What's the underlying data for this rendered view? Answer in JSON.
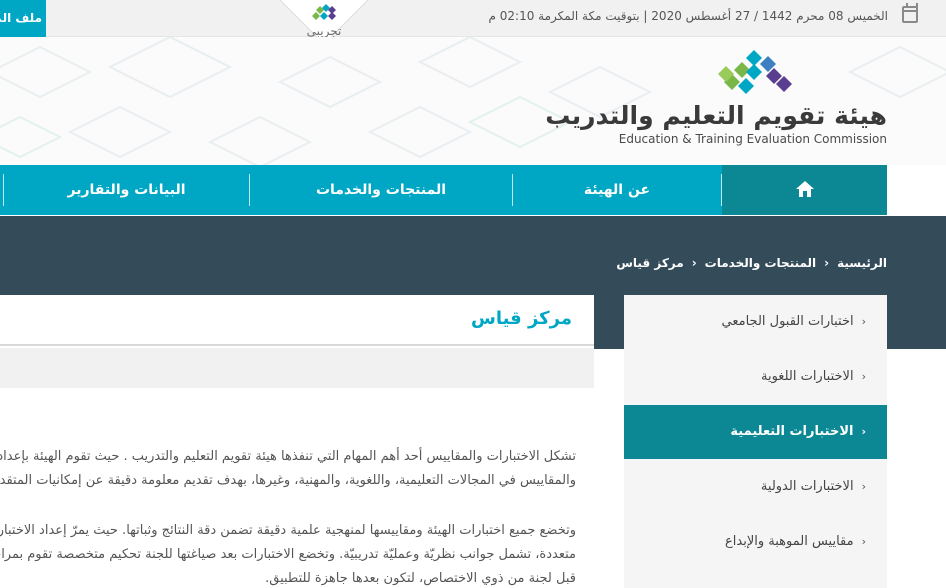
{
  "topbar": {
    "date_text": "الخميس 08 محرم 1442 / 27 أغسطس 2020 | بتوقيت مكة المكرمة 02:10 م",
    "profile_label": "ملف الم",
    "tajribi_label": "تجريبي"
  },
  "header": {
    "org_name_ar": "هيئة تقويم التعليم والتدريب",
    "org_name_en": "Education & Training Evaluation Commission",
    "colors": {
      "green": "#7ab648",
      "teal": "#00a7c4",
      "purple": "#5a3e8f"
    }
  },
  "nav": {
    "items": [
      {
        "label": "عن الهيئة"
      },
      {
        "label": "المنتجات والخدمات"
      },
      {
        "label": "البيانات والتقارير"
      }
    ],
    "home_icon": "home-icon"
  },
  "breadcrumb": {
    "items": [
      "الرئيسية",
      "المنتجات والخدمات",
      "مركز قياس"
    ],
    "separator": "‹"
  },
  "sidebar": {
    "items": [
      {
        "label": "اختبارات القبول الجامعي",
        "active": false
      },
      {
        "label": "الاختبارات اللغوية",
        "active": false
      },
      {
        "label": "الاختبارات التعليمية",
        "active": true
      },
      {
        "label": "الاختبارات الدولية",
        "active": false
      },
      {
        "label": "مقاييس الموهبة والإبداع",
        "active": false
      }
    ],
    "chevron": "‹"
  },
  "main": {
    "title": "مركز قياس",
    "paragraphs": [
      "تشكل الاختبارات والمقاييس أحد أهم المهام التي تنفذها هيئة تقويم التعليم والتدريب . حيث تقوم الهيئة بإعداد الاختبارات",
      "والمقاييس في المجالات التعليمية، واللغوية، والمهنية، وغيرها، بهدف تقديم معلومة دقيقة عن إمكانيات المتقدمين",
      "وتخضع جميع اختبارات الهيئة ومقاييسها لمنهجية علمية دقيقة تضمن دقة النتائج وثباتها. حيث يمرّ إعداد الاختبار بمراحل",
      "متعددة، تشمل جوانب نظريّة وعمليّة تدريبيّة. وتخضع الاختبارات بعد صياغتها للجنة تحكيم متخصصة تقوم بمراجعتها من",
      "قبل لجنة من ذوي الاختصاص، لتكون بعدها جاهزة للتطبيق."
    ]
  }
}
